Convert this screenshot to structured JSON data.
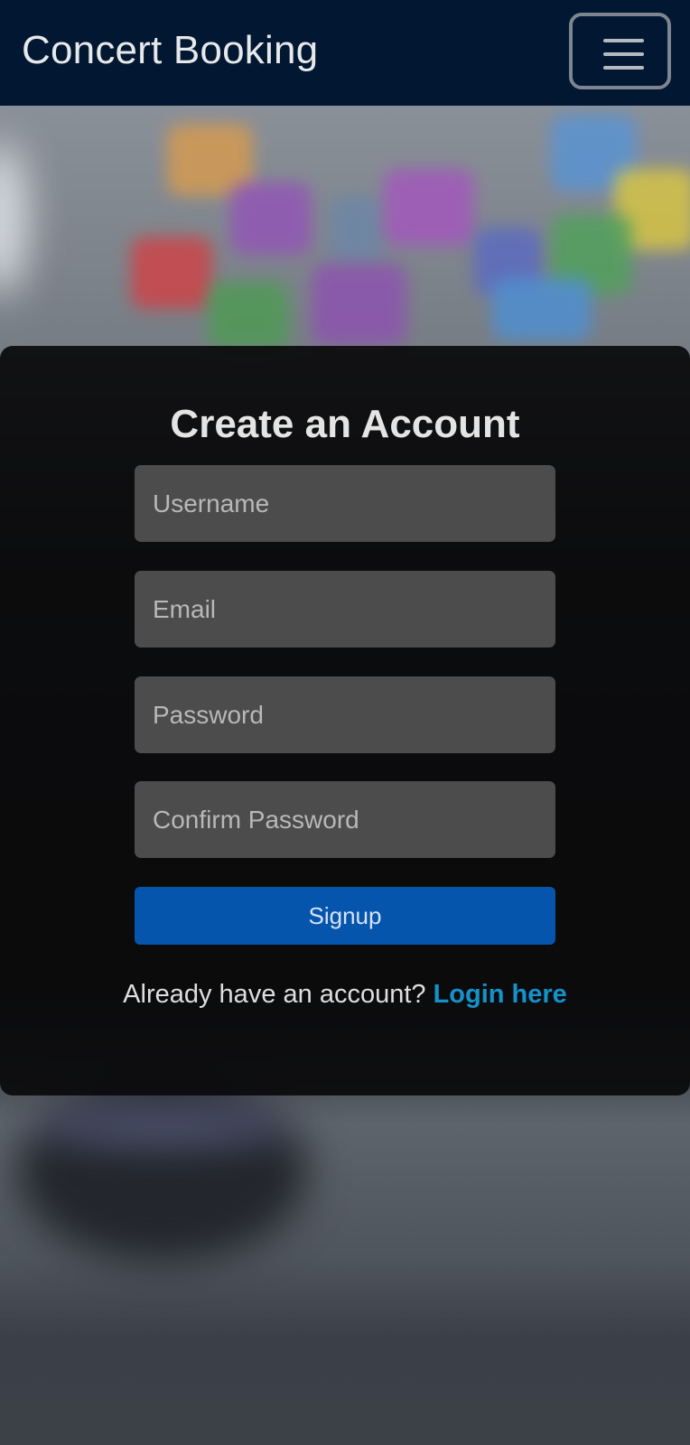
{
  "navbar": {
    "brand": "Concert Booking",
    "menu_icon": "hamburger-menu-icon"
  },
  "form": {
    "title": "Create an Account",
    "username_placeholder": "Username",
    "email_placeholder": "Email",
    "password_placeholder": "Password",
    "confirm_placeholder": "Confirm Password",
    "submit_label": "Signup",
    "login_prompt": "Already have an account?",
    "login_link": "Login here"
  },
  "colors": {
    "navbar_bg": "#021731",
    "button_bg": "#0655ad",
    "link": "#1592c9"
  }
}
